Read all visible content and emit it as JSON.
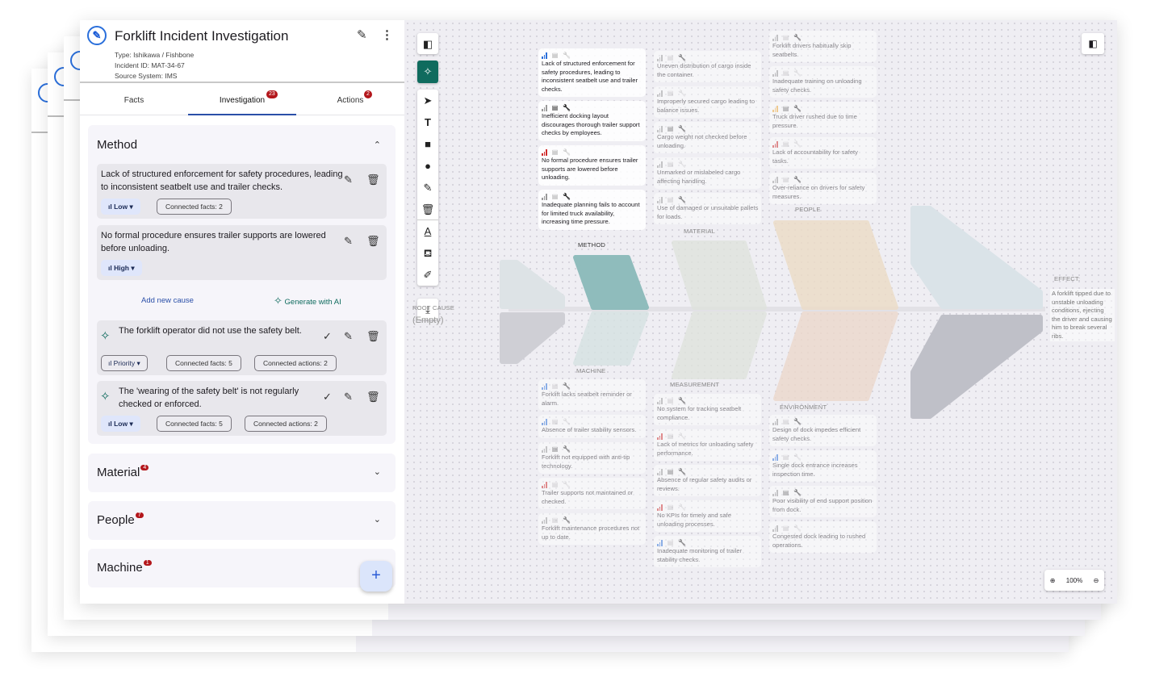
{
  "app": {
    "title": "Forklift Incident Investigation",
    "type": "Type: Ishikawa / Fishbone",
    "incident_id": "Incident ID: MAT-34-67",
    "source": "Source System: IMS",
    "logo_icon": "logo-icon",
    "colors": {
      "accent": "#2a4fa8",
      "badge": "#b3161b",
      "ai": "#0f6b5e",
      "low": "#2a6fdb",
      "high": "#d02a2a",
      "medium": "#f0a830"
    }
  },
  "tabs": [
    {
      "label": "Facts"
    },
    {
      "label": "Investigation",
      "badge": "23"
    },
    {
      "label": "Actions",
      "badge": "2"
    }
  ],
  "method": {
    "title": "Method",
    "causes": [
      {
        "text": "Lack of structured enforcement for safety procedures, leading to inconsistent seatbelt use and trailer checks.",
        "priority": "Low",
        "facts": "Connected facts: 2"
      },
      {
        "text": "No formal procedure ensures trailer supports are lowered before unloading.",
        "priority": "High"
      }
    ],
    "add_cause": "Add new cause",
    "generate_ai": "Generate with AI",
    "ai_causes": [
      {
        "text": "The forklift operator did not use the safety belt.",
        "priority": "Priority",
        "facts": "Connected facts: 5",
        "actions": "Connected actions: 2"
      },
      {
        "text": "The 'wearing of the safety belt' is not regularly checked or enforced.",
        "priority": "Low",
        "facts": "Connected facts: 5",
        "actions": "Connected actions: 2"
      }
    ]
  },
  "sections": [
    {
      "title": "Material",
      "badge": "4"
    },
    {
      "title": "People",
      "badge": "7"
    },
    {
      "title": "Machine",
      "badge": "1"
    }
  ],
  "fab": "+",
  "canvas": {
    "root_cause_label": "ROOT CAUSE",
    "root_cause_value": "(Empty)",
    "effect_label": "EFFECT:",
    "effect_text": "A forklift tipped due to unstable unloading conditions, ejecting the driver and causing him to break several ribs.",
    "zoom": "100%",
    "categories": [
      {
        "name": "METHOD",
        "color": "#8fbcbc",
        "faded": false,
        "cards": [
          {
            "text": "Lack of structured enforcement for safety procedures, leading to inconsistent seatbelt use and trailer checks.",
            "priority": "low",
            "facts": false,
            "actions": false
          },
          {
            "text": "Inefficient docking layout discourages thorough trailer support checks by employees.",
            "priority": "none",
            "facts": true,
            "actions": true
          },
          {
            "text": "No formal procedure ensures trailer supports are lowered before unloading.",
            "priority": "high",
            "facts": false,
            "actions": false
          },
          {
            "text": "Inadequate planning fails to account for limited truck availability, increasing time pressure.",
            "priority": "none",
            "facts": false,
            "actions": true
          }
        ]
      },
      {
        "name": "MATERIAL",
        "color": "#dfe3dd",
        "faded": true,
        "cards": [
          {
            "text": "Uneven distribution of cargo inside the container.",
            "priority": "none",
            "facts": false,
            "actions": true
          },
          {
            "text": "Improperly secured cargo leading to balance issues.",
            "priority": "none",
            "facts": false,
            "actions": false
          },
          {
            "text": "Cargo weight not checked before unloading.",
            "priority": "none",
            "facts": true,
            "actions": true
          },
          {
            "text": "Unmarked or mislabeled cargo affecting handling.",
            "priority": "none",
            "facts": false,
            "actions": false
          },
          {
            "text": "Use of damaged or unsuitable pallets for loads.",
            "priority": "none",
            "facts": false,
            "actions": true
          }
        ]
      },
      {
        "name": "PEOPLE",
        "color": "#ecdcc6",
        "faded": true,
        "cards": [
          {
            "text": "Forklift drivers habitually skip seatbelts.",
            "priority": "none",
            "facts": false,
            "actions": true
          },
          {
            "text": "Inadequate training on unloading safety checks.",
            "priority": "none",
            "facts": false,
            "actions": false
          },
          {
            "text": "Truck driver rushed due to time pressure.",
            "priority": "medium",
            "facts": true,
            "actions": true
          },
          {
            "text": "Lack of accountability for safety tasks.",
            "priority": "high",
            "facts": false,
            "actions": false
          },
          {
            "text": "Over-reliance on drivers for safety measures.",
            "priority": "none",
            "facts": false,
            "actions": true
          }
        ]
      },
      {
        "name": "MACHINE",
        "color": "#d5e2e2",
        "faded": true,
        "cards": [
          {
            "text": "Forklift lacks seatbelt reminder or alarm.",
            "priority": "low",
            "facts": false,
            "actions": true
          },
          {
            "text": "Absence of trailer stability sensors.",
            "priority": "low",
            "facts": false,
            "actions": false
          },
          {
            "text": "Forklift not equipped with anti-tip technology.",
            "priority": "none",
            "facts": true,
            "actions": true
          },
          {
            "text": "Trailer supports not maintained or checked.",
            "priority": "high",
            "facts": false,
            "actions": false
          },
          {
            "text": "Forklift maintenance procedures not up to date.",
            "priority": "none",
            "facts": false,
            "actions": true
          }
        ]
      },
      {
        "name": "MEASUREMENT",
        "color": "#dfe3dd",
        "faded": true,
        "cards": [
          {
            "text": "No system for tracking seatbelt compliance.",
            "priority": "none",
            "facts": false,
            "actions": true
          },
          {
            "text": "Lack of metrics for unloading safety performance.",
            "priority": "high",
            "facts": false,
            "actions": false
          },
          {
            "text": "Absence of regular safety audits or reviews.",
            "priority": "none",
            "facts": true,
            "actions": true
          },
          {
            "text": "No KPIs for timely and safe unloading processes.",
            "priority": "high",
            "facts": false,
            "actions": false
          },
          {
            "text": "Inadequate monitoring of trailer stability checks.",
            "priority": "low",
            "facts": false,
            "actions": true
          }
        ]
      },
      {
        "name": "ENVIRONMENT",
        "color": "#ecd8cc",
        "faded": true,
        "cards": [
          {
            "text": "Design of dock impedes efficient safety checks.",
            "priority": "none",
            "facts": false,
            "actions": true
          },
          {
            "text": "Single dock entrance increases inspection time.",
            "priority": "low",
            "facts": false,
            "actions": false
          },
          {
            "text": "Poor visibility of end support position from dock.",
            "priority": "none",
            "facts": true,
            "actions": true
          },
          {
            "text": "Congested dock leading to rushed operations.",
            "priority": "none",
            "facts": false,
            "actions": false
          }
        ]
      }
    ]
  }
}
